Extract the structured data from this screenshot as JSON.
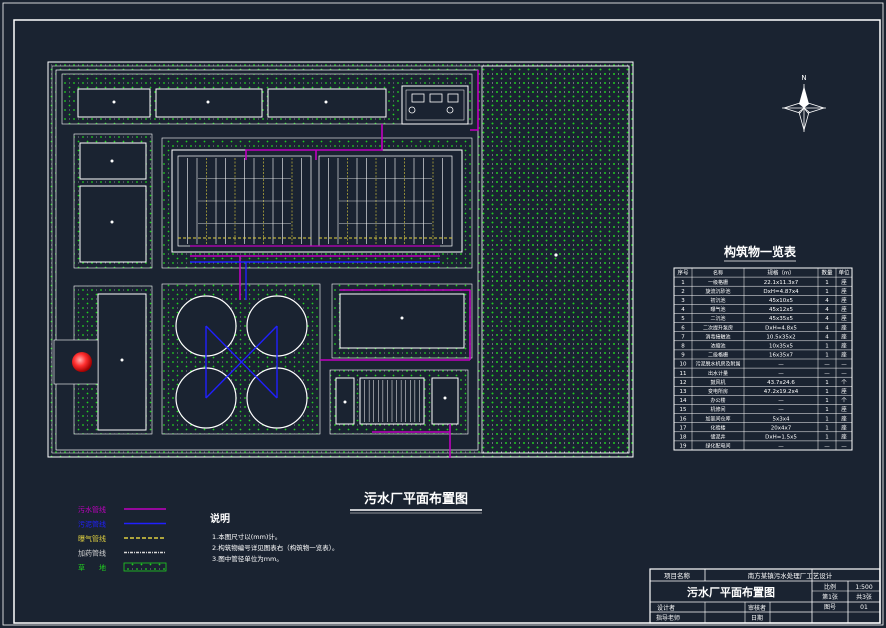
{
  "drawing": {
    "main_title": "污水厂平面布置图",
    "colors": {
      "background": "#1a2331",
      "line": "#ffffff",
      "sewage_pipe": "#c000c0",
      "sludge_pipe": "#2020ff",
      "aeration_pipe": "#e0d040",
      "dosing_pipe": "#d8d8d8",
      "grass": "#20d020"
    }
  },
  "legend": [
    {
      "label": "污水管线",
      "color": "#c000c0"
    },
    {
      "label": "污泥管线",
      "color": "#2020ff"
    },
    {
      "label": "曝气管线",
      "color": "#e0d040"
    },
    {
      "label": "加药管线",
      "color": "#d8d8d8"
    },
    {
      "label": "草　　地",
      "color": "#20d020"
    }
  ],
  "notes": {
    "title": "说明",
    "items": [
      "1.本图尺寸以(mm)计。",
      "2.构筑物编号详见图表右（构筑物一览表）。",
      "3.图中管径单位为mm。"
    ]
  },
  "structures_table": {
    "title": "构筑物一览表",
    "headers": [
      "序号",
      "名称",
      "规格（m）",
      "数量",
      "单位"
    ],
    "rows": [
      [
        "1",
        "一级格栅",
        "22.1x11.3x7",
        "1",
        "座"
      ],
      [
        "2",
        "旋流沉砂池",
        "DxH=4.87x4",
        "1",
        "座"
      ],
      [
        "3",
        "初沉池",
        "45x10x5",
        "4",
        "座"
      ],
      [
        "4",
        "曝气池",
        "45x12x5",
        "4",
        "座"
      ],
      [
        "5",
        "二沉池",
        "45x35x5",
        "4",
        "座"
      ],
      [
        "6",
        "二次提升泵房",
        "DxH=4.8x5",
        "4",
        "座"
      ],
      [
        "7",
        "消毒接触池",
        "10.5x35x2",
        "4",
        "座"
      ],
      [
        "8",
        "浓缩池",
        "10x35x5",
        "1",
        "座"
      ],
      [
        "9",
        "二级格栅",
        "16x35x7",
        "1",
        "座"
      ],
      [
        "10",
        "污泥脱水机房及附属",
        "—",
        "—",
        "—"
      ],
      [
        "11",
        "出水计量",
        "—",
        "—",
        "—"
      ],
      [
        "12",
        "鼓风机",
        "43.7x24.6",
        "1",
        "个"
      ],
      [
        "13",
        "变电所房",
        "47.2x19.2x4",
        "1",
        "座"
      ],
      [
        "14",
        "办公楼",
        "—",
        "1",
        "个"
      ],
      [
        "15",
        "机修间",
        "—",
        "1",
        "座"
      ],
      [
        "16",
        "加氯间仓库",
        "5x3x4",
        "1",
        "座"
      ],
      [
        "17",
        "化验楼",
        "20x4x7",
        "1",
        "座"
      ],
      [
        "18",
        "储泥井",
        "DxH=1.5x5",
        "1",
        "座"
      ],
      [
        "19",
        "绿化配电间",
        "—",
        "—",
        "—"
      ]
    ]
  },
  "title_block": {
    "project_label": "项目名称",
    "project_name": "南方某镇污水处理厂工艺设计",
    "drawing_name": "污水厂平面布置图",
    "scale_label": "比例",
    "scale_value": "1:500",
    "sheet_label": "第1张",
    "sheet_total": "共3张",
    "fig_label": "图号",
    "fig_value": "01",
    "designer_label": "设计者",
    "reviewer_label": "审核者",
    "teacher_label": "指导老师",
    "date_label": "日期"
  },
  "north_label": "N"
}
